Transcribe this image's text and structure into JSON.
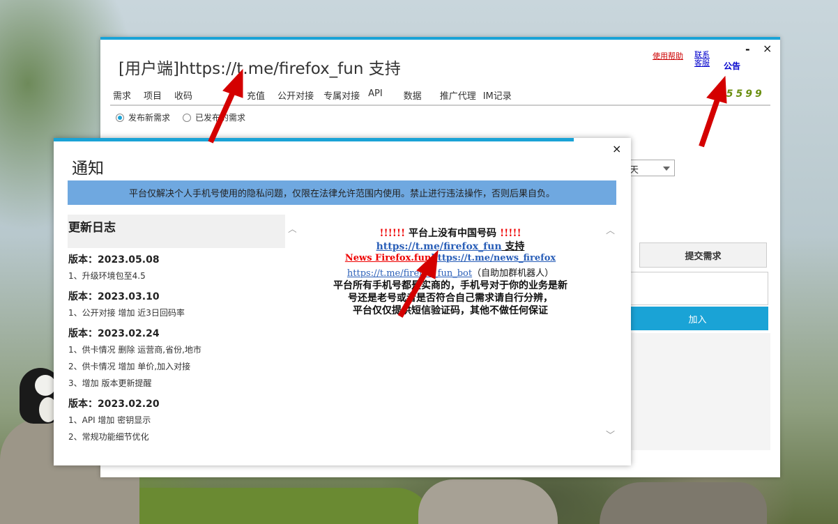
{
  "window": {
    "title": "[用户端]https://t.me/firefox_fun 支持",
    "help_link": "使用帮助",
    "contact_link": "联系客服",
    "notice_link": "公告",
    "min_btn": "-",
    "close_btn": "×",
    "tabs": [
      "需求",
      "项目",
      "收码",
      "",
      "充值",
      "公开对接",
      "专属对接",
      "API",
      "数据",
      "推广代理",
      "IM记录"
    ],
    "digits": "15599",
    "radios": [
      {
        "label": "发布新需求",
        "checked": true
      },
      {
        "label": "已发布的需求",
        "checked": false
      }
    ],
    "select_value": "天",
    "submit_label": "提交需求",
    "join_label": "加入"
  },
  "dialog": {
    "title": "通知",
    "close": "×",
    "banner": "平台仅解决个人手机号使用的隐私问题，仅限在法律允许范围内使用。禁止进行违法操作，否则后果自负。",
    "changelog_title": "更新日志",
    "changelog": [
      {
        "version": "版本：2023.05.08",
        "notes": [
          "1、升级环境包至4.5"
        ]
      },
      {
        "version": "版本：2023.03.10",
        "notes": [
          "1、公开对接 增加 近3日回码率"
        ]
      },
      {
        "version": "版本：2023.02.24",
        "notes": [
          "1、供卡情况 删除 运营商,省份,地市",
          "2、供卡情况 增加 单价,加入对接",
          "3、增加 版本更新提醒"
        ]
      },
      {
        "version": "版本：2023.02.20",
        "notes": [
          "1、API 增加 密钥显示",
          "2、常规功能细节优化"
        ]
      }
    ],
    "content": {
      "line1_excl_left": "!!!!!!",
      "line1_text": " 平台上没有中国号码 ",
      "line1_excl_right": "!!!!!",
      "line2_link": "https://t.me/firefox_fun",
      "line2_text": " 支持",
      "line3_news": "News Firefox.fun",
      "line3_link": "https://t.me/news_firefox",
      "line4_link": "https://t.me/firefox_fun_bot",
      "line4_text": "（自助加群机器人）",
      "para": [
        "平台所有手机号都是实商的，手机号对于你的业务是新",
        "号还是老号或者是否符合自己需求请自行分辨，",
        "平台仅仅提供短信验证码，其他不做任何保证"
      ]
    }
  },
  "colors": {
    "accent": "#1aa3d6",
    "banner": "#6fa8e0",
    "arrow": "#d40000"
  }
}
